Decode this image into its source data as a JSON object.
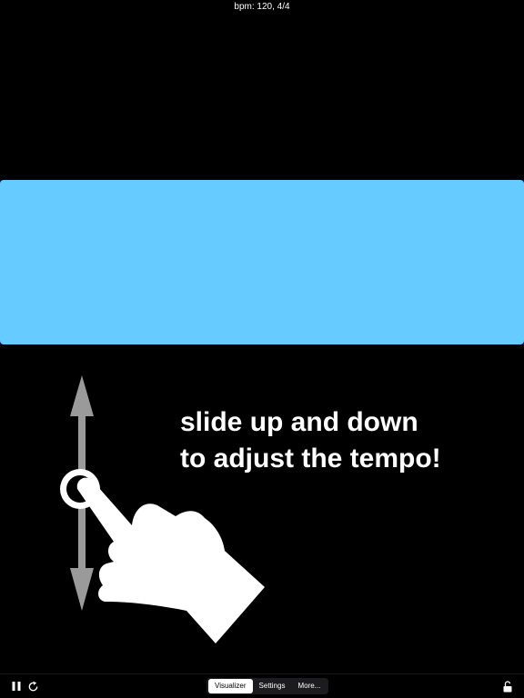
{
  "status": {
    "text": "bpm: 120, 4/4"
  },
  "visualizer": {
    "bar_color": "#66CCFF"
  },
  "hint": {
    "line1": "slide up and down",
    "line2": "to adjust the tempo!",
    "icon": "swipe-hand-icon"
  },
  "toolbar": {
    "pause_icon": "pause-icon",
    "reset_icon": "reset-icon",
    "lock_icon": "unlocked-lock-icon",
    "tabs": [
      {
        "label": "Visualizer",
        "active": true
      },
      {
        "label": "Settings",
        "active": false
      },
      {
        "label": "More...",
        "active": false
      }
    ]
  }
}
